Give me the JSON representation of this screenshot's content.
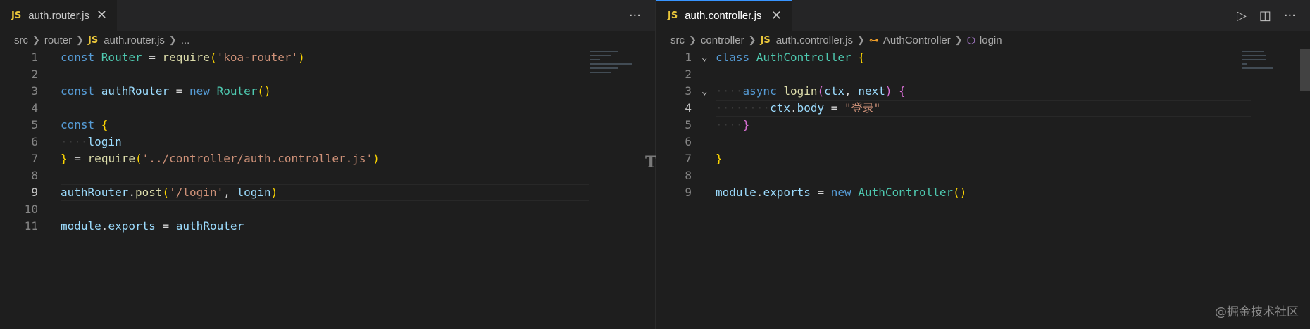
{
  "left": {
    "tab": {
      "badge": "JS",
      "label": "auth.router.js",
      "close": "✕"
    },
    "actions_more": "···",
    "breadcrumb": {
      "parts": [
        "src",
        "router"
      ],
      "js_badge": "JS",
      "file": "auth.router.js",
      "tail": "..."
    },
    "lines": [
      {
        "n": "1",
        "tokens": [
          [
            "const ",
            "kw"
          ],
          [
            "Router",
            "cls"
          ],
          [
            " = ",
            "plain"
          ],
          [
            "require",
            "fn"
          ],
          [
            "(",
            "br1"
          ],
          [
            "'koa-router'",
            "str"
          ],
          [
            ")",
            "br1"
          ]
        ]
      },
      {
        "n": "2",
        "tokens": []
      },
      {
        "n": "3",
        "tokens": [
          [
            "const ",
            "kw"
          ],
          [
            "authRouter",
            "var"
          ],
          [
            " = ",
            "plain"
          ],
          [
            "new ",
            "kw"
          ],
          [
            "Router",
            "cls"
          ],
          [
            "()",
            "br1"
          ]
        ]
      },
      {
        "n": "4",
        "tokens": []
      },
      {
        "n": "5",
        "tokens": [
          [
            "const ",
            "kw"
          ],
          [
            "{",
            "br1"
          ]
        ]
      },
      {
        "n": "6",
        "tokens": [
          [
            "····",
            "ws"
          ],
          [
            "login",
            "var"
          ]
        ]
      },
      {
        "n": "7",
        "tokens": [
          [
            "}",
            "br1"
          ],
          [
            " = ",
            "plain"
          ],
          [
            "require",
            "fn"
          ],
          [
            "(",
            "br1"
          ],
          [
            "'../controller/auth.controller.js'",
            "str"
          ],
          [
            ")",
            "br1"
          ]
        ]
      },
      {
        "n": "8",
        "tokens": []
      },
      {
        "n": "9",
        "tokens": [
          [
            "authRouter",
            "var"
          ],
          [
            ".",
            "plain"
          ],
          [
            "post",
            "fn"
          ],
          [
            "(",
            "br1"
          ],
          [
            "'/login'",
            "str"
          ],
          [
            ", ",
            "plain"
          ],
          [
            "login",
            "var"
          ],
          [
            ")",
            "br1"
          ]
        ],
        "active": true
      },
      {
        "n": "10",
        "tokens": []
      },
      {
        "n": "11",
        "tokens": [
          [
            "module",
            "var"
          ],
          [
            ".",
            "plain"
          ],
          [
            "exports",
            "var"
          ],
          [
            " = ",
            "plain"
          ],
          [
            "authRouter",
            "var"
          ]
        ]
      }
    ]
  },
  "right": {
    "tab": {
      "badge": "JS",
      "label": "auth.controller.js",
      "close": "✕"
    },
    "actions": {
      "run": "▷",
      "split": "◫",
      "more": "···"
    },
    "breadcrumb": {
      "parts": [
        "src",
        "controller"
      ],
      "js_badge": "JS",
      "file": "auth.controller.js",
      "class_icon": "⊶",
      "class_name": "AuthController",
      "method_icon": "⬡",
      "method_name": "login"
    },
    "lines": [
      {
        "n": "1",
        "fold": "⌄",
        "tokens": [
          [
            "class ",
            "kw"
          ],
          [
            "AuthController",
            "cls"
          ],
          [
            " {",
            "br1"
          ]
        ]
      },
      {
        "n": "2",
        "tokens": []
      },
      {
        "n": "3",
        "fold": "⌄",
        "tokens": [
          [
            "····",
            "ws"
          ],
          [
            "async ",
            "kw"
          ],
          [
            "login",
            "fn"
          ],
          [
            "(",
            "br2"
          ],
          [
            "ctx",
            "var"
          ],
          [
            ", ",
            "plain"
          ],
          [
            "next",
            "var"
          ],
          [
            ")",
            "br2"
          ],
          [
            " {",
            "br2"
          ]
        ]
      },
      {
        "n": "4",
        "tokens": [
          [
            "········",
            "ws"
          ],
          [
            "ctx",
            "var"
          ],
          [
            ".",
            "plain"
          ],
          [
            "body",
            "var"
          ],
          [
            " = ",
            "plain"
          ],
          [
            "\"登录\"",
            "str"
          ]
        ],
        "active": true
      },
      {
        "n": "5",
        "tokens": [
          [
            "····",
            "ws"
          ],
          [
            "}",
            "br2"
          ]
        ]
      },
      {
        "n": "6",
        "tokens": []
      },
      {
        "n": "7",
        "tokens": [
          [
            "}",
            "br1"
          ]
        ]
      },
      {
        "n": "8",
        "tokens": []
      },
      {
        "n": "9",
        "tokens": [
          [
            "module",
            "var"
          ],
          [
            ".",
            "plain"
          ],
          [
            "exports",
            "var"
          ],
          [
            " = ",
            "plain"
          ],
          [
            "new ",
            "kw"
          ],
          [
            "AuthController",
            "cls"
          ],
          [
            "()",
            "br1"
          ]
        ]
      }
    ]
  },
  "drag_marker": "T",
  "watermark": "@掘金技术社区"
}
